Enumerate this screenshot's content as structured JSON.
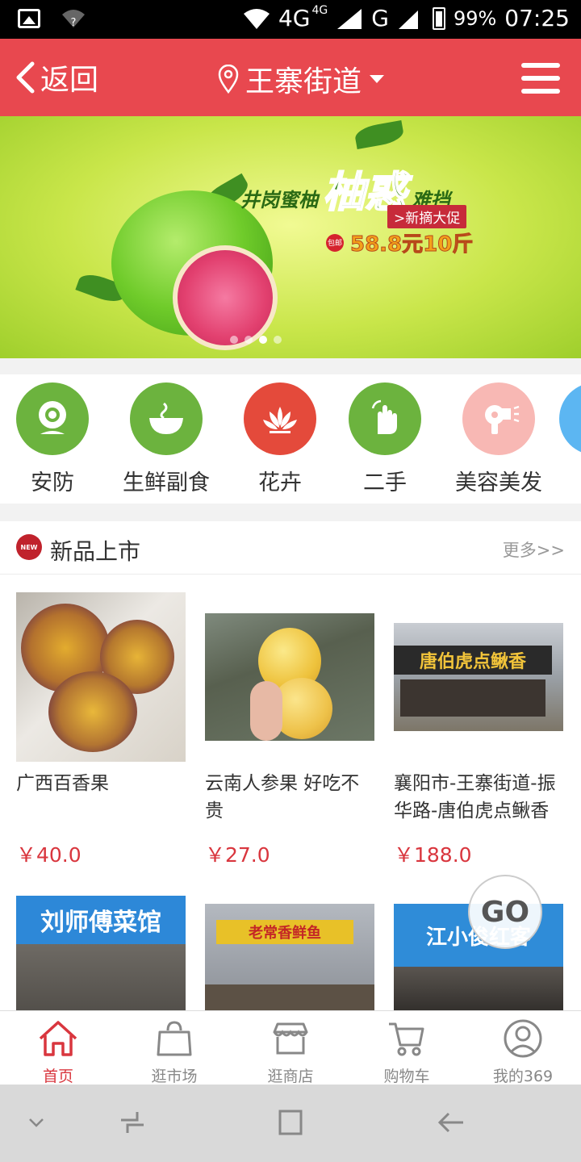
{
  "status_bar": {
    "network": "4G",
    "network_small": "4G",
    "network2": "G",
    "battery": "99%",
    "time": "07:25"
  },
  "header": {
    "back_label": "返回",
    "location": "王寨街道",
    "background_color": "#e8484f"
  },
  "banner": {
    "slogan_prefix": "井岗蜜柚",
    "slogan_big": "柚惑",
    "slogan_suffix": "难挡",
    "promo_tag": ">新摘大促",
    "price_text": "58.8元10斤",
    "slide_count": 4,
    "active_slide": 3
  },
  "categories": [
    {
      "label": "安防",
      "icon": "webcam-icon",
      "color": "#6cb33e"
    },
    {
      "label": "生鲜副食",
      "icon": "bowl-icon",
      "color": "#6cb33e"
    },
    {
      "label": "花卉",
      "icon": "lotus-icon",
      "color": "#e44a3b"
    },
    {
      "label": "二手",
      "icon": "hand-icon",
      "color": "#6cb33e"
    },
    {
      "label": "美容美发",
      "icon": "hairdryer-icon",
      "color": "#f8b8b4"
    }
  ],
  "new_products": {
    "title": "新品上市",
    "badge": "NEW",
    "more_label": "更多>>",
    "items": [
      {
        "name": "广西百香果",
        "price": "￥40.0"
      },
      {
        "name": "云南人参果 好吃不贵",
        "price": "￥27.0"
      },
      {
        "name": "襄阳市-王寨街道-振华路-唐伯虎点鳅香",
        "price": "￥188.0"
      }
    ],
    "shop_signs": [
      "刘师傅菜馆",
      "老常香鲜鱼",
      "江小俊红客"
    ]
  },
  "go_label": "GO",
  "tabbar": [
    {
      "label": "首页",
      "icon": "home-icon",
      "active": true
    },
    {
      "label": "逛市场",
      "icon": "bag-icon",
      "active": false
    },
    {
      "label": "逛商店",
      "icon": "store-icon",
      "active": false
    },
    {
      "label": "购物车",
      "icon": "cart-icon",
      "active": false
    },
    {
      "label": "我的369",
      "icon": "profile-icon",
      "active": false
    }
  ],
  "accent_color": "#d9363e"
}
